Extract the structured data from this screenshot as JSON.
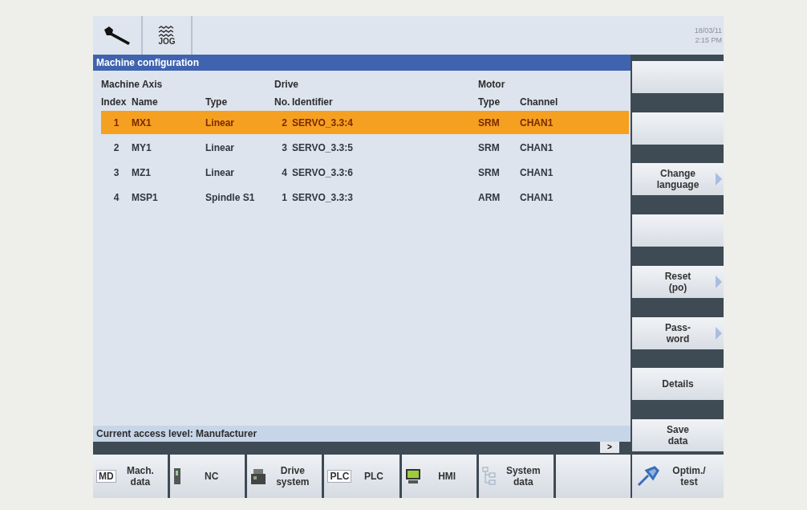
{
  "top_bar": {
    "mode_label": "JOG",
    "date": "18/03/11",
    "time": "2:15 PM"
  },
  "window": {
    "title": "Machine configuration"
  },
  "table": {
    "group_headers": [
      "Machine Axis",
      "Drive",
      "Motor"
    ],
    "columns": [
      "Index",
      "Name",
      "Type",
      "No.",
      "Identifier",
      "Type",
      "Channel"
    ],
    "rows": [
      {
        "selected": true,
        "cells": [
          "1",
          "MX1",
          "Linear",
          "2",
          "SERVO_3.3:4",
          "SRM",
          "CHAN1"
        ]
      },
      {
        "selected": false,
        "cells": [
          "2",
          "MY1",
          "Linear",
          "3",
          "SERVO_3.3:5",
          "SRM",
          "CHAN1"
        ]
      },
      {
        "selected": false,
        "cells": [
          "3",
          "MZ1",
          "Linear",
          "4",
          "SERVO_3.3:6",
          "SRM",
          "CHAN1"
        ]
      },
      {
        "selected": false,
        "cells": [
          "4",
          "MSP1",
          "Spindle S1",
          "1",
          "SERVO_3.3:3",
          "ARM",
          "CHAN1"
        ]
      }
    ]
  },
  "status_line": "Current access level: Manufacturer",
  "scroll_button": ">",
  "vertical_softkeys": [
    {
      "arrow": false
    },
    {
      "arrow": false
    },
    {
      "lines": [
        "Change",
        "language"
      ],
      "arrow": true
    },
    {
      "arrow": false
    },
    {
      "lines": [
        "Reset",
        "(po)"
      ],
      "arrow": true
    },
    {
      "lines": [
        "Pass-",
        "word"
      ],
      "arrow": true
    },
    {
      "lines": [
        "Details"
      ],
      "arrow": false
    },
    {
      "lines": [
        "Save",
        "data"
      ],
      "arrow": false
    }
  ],
  "horizontal_softkeys": [
    {
      "kind": "text_icon",
      "icon_text": "MD",
      "lines": [
        "Mach.",
        "data"
      ]
    },
    {
      "kind": "cabinet",
      "lines": [
        "NC"
      ]
    },
    {
      "kind": "drive",
      "lines": [
        "Drive",
        "system"
      ]
    },
    {
      "kind": "text_icon",
      "icon_text": "PLC",
      "lines": [
        "PLC"
      ]
    },
    {
      "kind": "monitor",
      "lines": [
        "HMI"
      ]
    },
    {
      "kind": "tree",
      "lines": [
        "System",
        "data"
      ]
    },
    {
      "kind": "empty"
    }
  ],
  "corner_softkey": {
    "lines": [
      "Optim./",
      "test"
    ]
  }
}
